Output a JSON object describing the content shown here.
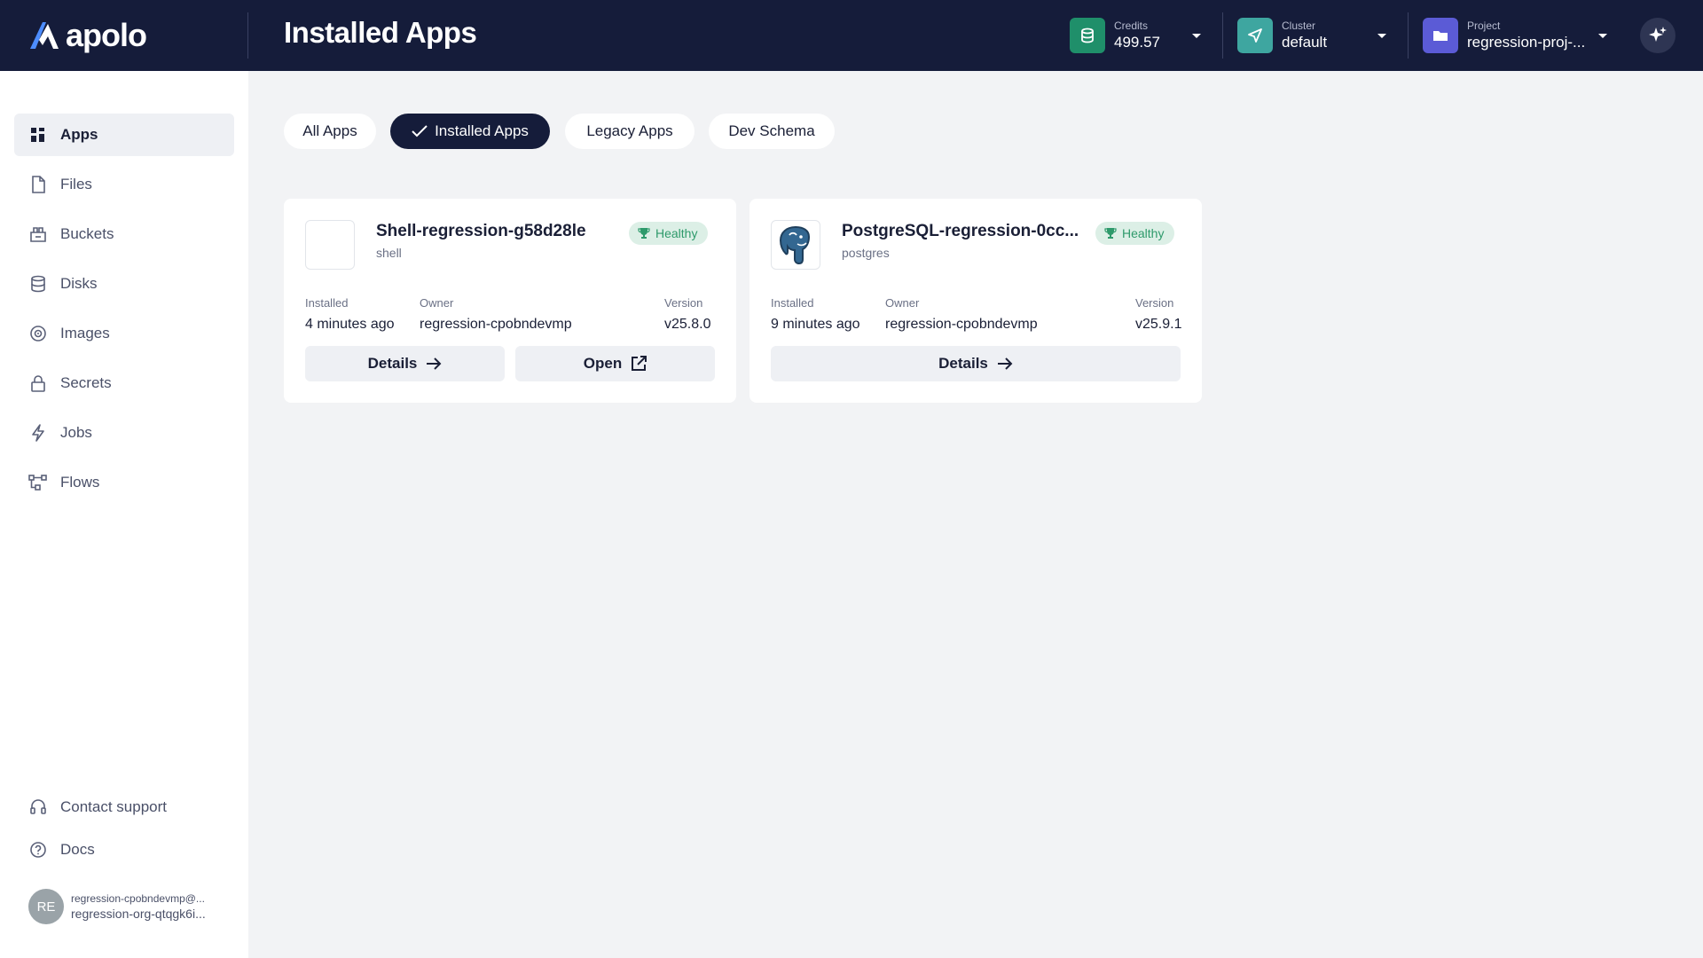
{
  "header": {
    "logo_text": "apolo",
    "page_title": "Installed Apps",
    "credits": {
      "label": "Credits",
      "value": "499.57",
      "color": "#1f8f6a"
    },
    "cluster": {
      "label": "Cluster",
      "value": "default",
      "color": "#3ea6a0"
    },
    "project": {
      "label": "Project",
      "value": "regression-proj-...",
      "color": "#5b5bd6"
    },
    "ai_button_icon": "sparkle-icon"
  },
  "sidebar": {
    "items": [
      {
        "label": "Apps",
        "icon": "apps-grid-icon",
        "active": true
      },
      {
        "label": "Files",
        "icon": "file-icon"
      },
      {
        "label": "Buckets",
        "icon": "bucket-icon"
      },
      {
        "label": "Disks",
        "icon": "database-icon"
      },
      {
        "label": "Images",
        "icon": "image-disc-icon"
      },
      {
        "label": "Secrets",
        "icon": "lock-icon"
      },
      {
        "label": "Jobs",
        "icon": "lightning-icon"
      },
      {
        "label": "Flows",
        "icon": "flow-icon"
      }
    ],
    "footer": [
      {
        "label": "Contact support",
        "icon": "headset-icon"
      },
      {
        "label": "Docs",
        "icon": "help-circle-icon"
      }
    ],
    "user": {
      "initials": "RE",
      "email": "regression-cpobndevmp@...",
      "org": "regression-org-qtqgk6i..."
    }
  },
  "tabs": [
    {
      "label": "All Apps"
    },
    {
      "label": "Installed Apps",
      "active": true
    },
    {
      "label": "Legacy Apps"
    },
    {
      "label": "Dev Schema"
    }
  ],
  "cards": [
    {
      "name": "Shell-regression-g58d28le",
      "type": "shell",
      "status": "Healthy",
      "installed_label": "Installed",
      "installed_value": "4 minutes ago",
      "owner_label": "Owner",
      "owner_value": "regression-cpobndevmp",
      "version_label": "Version",
      "version_value": "v25.8.0",
      "details_label": "Details",
      "open_label": "Open"
    },
    {
      "name": "PostgreSQL-regression-0cc...",
      "type": "postgres",
      "status": "Healthy",
      "installed_label": "Installed",
      "installed_value": "9 minutes ago",
      "owner_label": "Owner",
      "owner_value": "regression-cpobndevmp",
      "version_label": "Version",
      "version_value": "v25.9.1",
      "details_label": "Details"
    }
  ]
}
